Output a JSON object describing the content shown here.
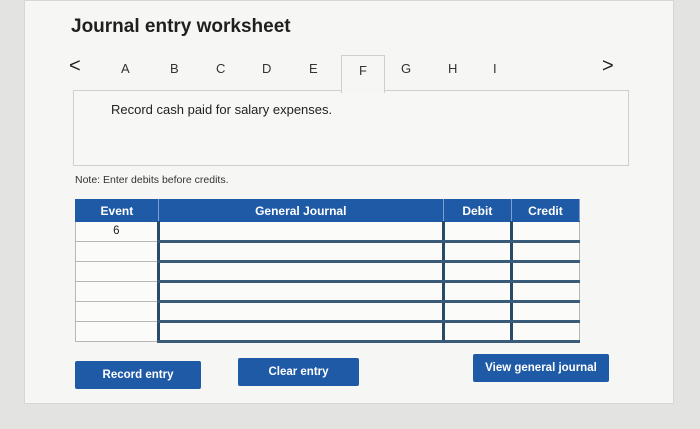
{
  "title": "Journal entry worksheet",
  "nav": {
    "prev": "<",
    "next": ">"
  },
  "tabs": [
    "A",
    "B",
    "C",
    "D",
    "E",
    "F",
    "G",
    "H",
    "I"
  ],
  "active_tab": "F",
  "instruction": "Record cash paid for salary expenses.",
  "note": "Note: Enter debits before credits.",
  "table": {
    "headers": [
      "Event",
      "General Journal",
      "Debit",
      "Credit"
    ],
    "rows": [
      {
        "event": "6",
        "account": "",
        "debit": "",
        "credit": ""
      },
      {
        "event": "",
        "account": "",
        "debit": "",
        "credit": ""
      },
      {
        "event": "",
        "account": "",
        "debit": "",
        "credit": ""
      },
      {
        "event": "",
        "account": "",
        "debit": "",
        "credit": ""
      },
      {
        "event": "",
        "account": "",
        "debit": "",
        "credit": ""
      },
      {
        "event": "",
        "account": "",
        "debit": "",
        "credit": ""
      }
    ]
  },
  "buttons": {
    "record": "Record entry",
    "clear": "Clear entry",
    "view": "View general journal"
  },
  "colors": {
    "accent": "#1f5aa6"
  }
}
